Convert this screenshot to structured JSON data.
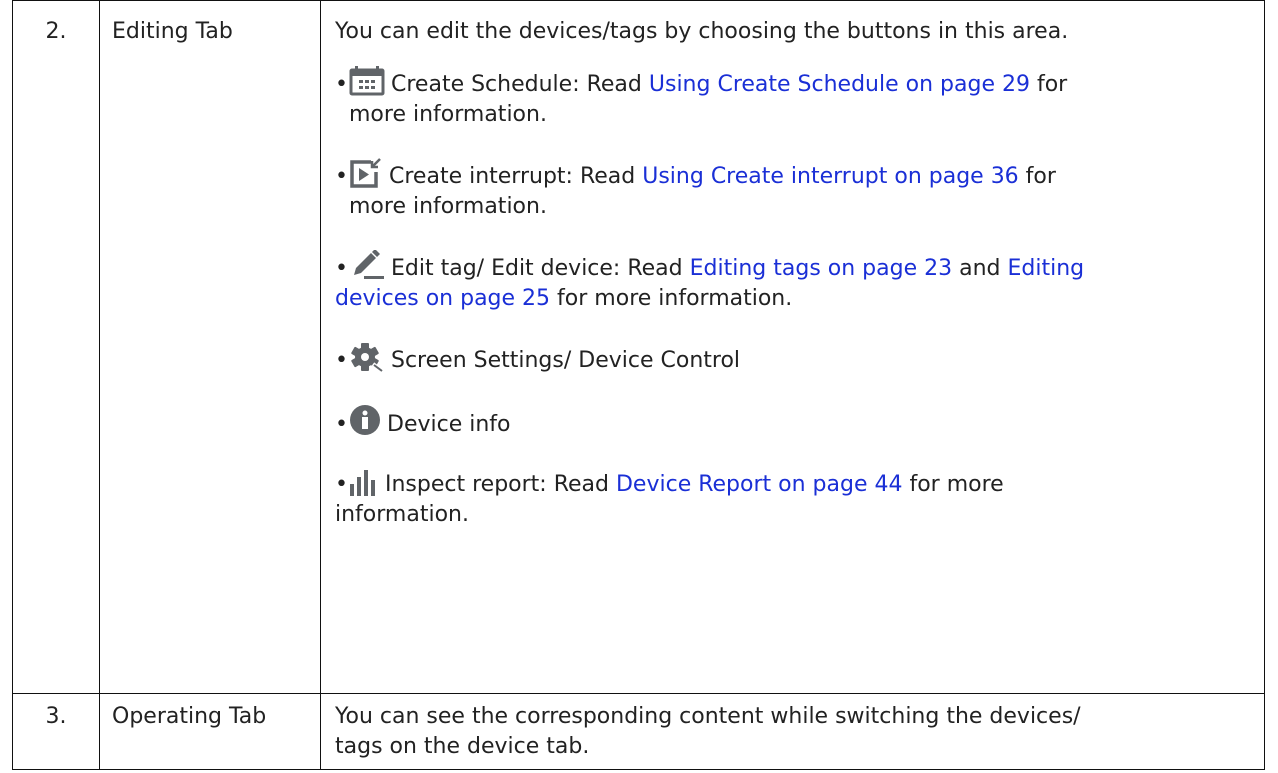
{
  "rows": [
    {
      "number": "2.",
      "name": "Editing Tab",
      "intro": "You can edit the devices/tags by choosing the buttons in this area.",
      "items": [
        {
          "icon": "calendar-icon",
          "label": "Create Schedule: Read ",
          "link1": "Using Create Schedule on page 29",
          "after1": " for",
          "cont": "more information."
        },
        {
          "icon": "interrupt-icon",
          "label": "Create interrupt: Read ",
          "link1": "Using Create interrupt on page 36",
          "after1": " for",
          "cont": "more information."
        },
        {
          "icon": "pencil-icon",
          "label": "Edit tag/ Edit device: Read ",
          "link1": "Editing tags on page 23",
          "between": " and ",
          "link2a": "Editing",
          "link2b": "devices on page 25",
          "after2": " for more information."
        },
        {
          "icon": "gear-icon",
          "label": "Screen Settings/ Device Control"
        },
        {
          "icon": "info-icon",
          "label": "Device info"
        },
        {
          "icon": "bar-chart-icon",
          "label": "Inspect report: Read ",
          "link1": "Device Report on page 44",
          "after1": " for more",
          "cont": "information."
        }
      ]
    },
    {
      "number": "3.",
      "name": "Operating Tab",
      "desc_line1": "You can see the corresponding content while switching the devices/",
      "desc_line2": "tags on the device tab."
    }
  ],
  "colors": {
    "link": "#1a2fd6",
    "icon": "#606468",
    "border": "#111111"
  }
}
